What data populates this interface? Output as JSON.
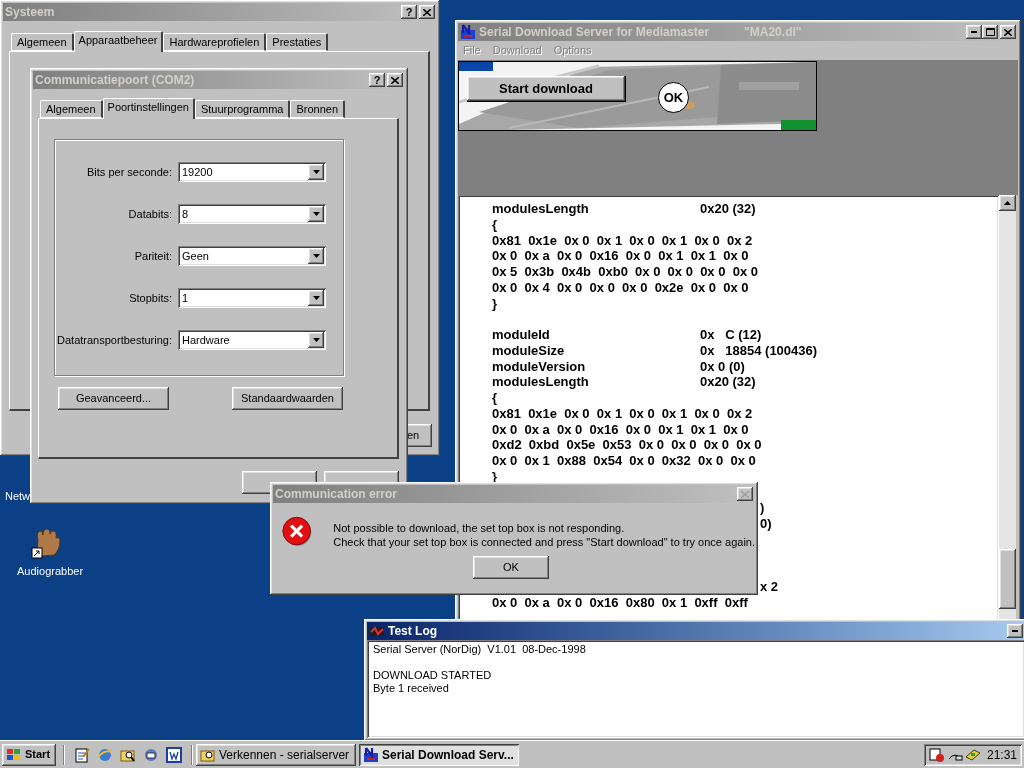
{
  "desktop_icons": [
    {
      "label": "Netw"
    },
    {
      "label": "Audiograbber"
    }
  ],
  "system_window": {
    "title": "Systeem",
    "active": false,
    "title_buttons": [
      {
        "kind": "help",
        "label": "?",
        "disabled": false
      },
      {
        "kind": "close",
        "disabled": false
      }
    ],
    "tabs": [
      {
        "label": "Algemeen",
        "selected": false
      },
      {
        "label": "Apparaatbeheer",
        "selected": true
      },
      {
        "label": "Hardwareprofielen",
        "selected": false
      },
      {
        "label": "Prestaties",
        "selected": false
      }
    ],
    "button_fragment": "en"
  },
  "port_dialog": {
    "title": "Communicatiepoort (COM2)",
    "active": false,
    "title_buttons": [
      {
        "kind": "help",
        "label": "?",
        "disabled": false
      },
      {
        "kind": "close",
        "disabled": false
      }
    ],
    "tabs": [
      {
        "label": "Algemeen",
        "selected": false
      },
      {
        "label": "Poortinstellingen",
        "selected": true
      },
      {
        "label": "Stuurprogramma",
        "selected": false
      },
      {
        "label": "Bronnen",
        "selected": false
      }
    ],
    "fields": [
      {
        "label": "Bits per seconde:",
        "value": "19200"
      },
      {
        "label": "Databits:",
        "value": "8"
      },
      {
        "label": "Pariteit:",
        "value": "Geen"
      },
      {
        "label": "Stopbits:",
        "value": "1"
      },
      {
        "label": "Datatransportbesturing:",
        "value": "Hardware"
      }
    ],
    "buttons": [
      "Geavanceerd...",
      "Standaardwaarden"
    ]
  },
  "serial_window": {
    "title": "Serial Download Server for Mediamaster",
    "file": "\"MA20.dl\"",
    "active": false,
    "title_buttons": [
      {
        "kind": "minimize",
        "disabled": false
      },
      {
        "kind": "maximize",
        "disabled": false
      },
      {
        "kind": "close",
        "disabled": false
      }
    ],
    "menu": [
      {
        "label": "File",
        "disabled": true
      },
      {
        "label": "Download",
        "disabled": true
      },
      {
        "label": "Options",
        "disabled": true
      }
    ],
    "start_button": "Start download",
    "status": "OK",
    "log_lines": [
      {
        "kind": "pair",
        "name": "modulesLength",
        "value": "0x20 (32)"
      },
      {
        "kind": "brace",
        "text": "{"
      },
      {
        "kind": "hex",
        "text": "0x81  0x1e  0x 0  0x 1  0x 0  0x 1  0x 0  0x 2"
      },
      {
        "kind": "hex",
        "text": "0x 0  0x a  0x 0  0x16  0x 0  0x 1  0x 1  0x 0"
      },
      {
        "kind": "hex",
        "text": "0x 5  0x3b  0x4b  0xb0  0x 0  0x 0  0x 0  0x 0"
      },
      {
        "kind": "hex",
        "text": "0x 0  0x 4  0x 0  0x 0  0x 0  0x2e  0x 0  0x 0"
      },
      {
        "kind": "brace",
        "text": "}"
      },
      {
        "kind": "blank"
      },
      {
        "kind": "pair",
        "name": "moduleId",
        "value": "0x   C (12)"
      },
      {
        "kind": "pair",
        "name": "moduleSize",
        "value": "0x   18854 (100436)"
      },
      {
        "kind": "pair",
        "name": "moduleVersion",
        "value": "0x 0 (0)"
      },
      {
        "kind": "pair",
        "name": "modulesLength",
        "value": "0x20 (32)"
      },
      {
        "kind": "brace",
        "text": "{"
      },
      {
        "kind": "hex",
        "text": "0x81  0x1e  0x 0  0x 1  0x 0  0x 1  0x 0  0x 2"
      },
      {
        "kind": "hex",
        "text": "0x 0  0x a  0x 0  0x16  0x 0  0x 1  0x 1  0x 0"
      },
      {
        "kind": "hex",
        "text": "0xd2  0xbd  0x5e  0x53  0x 0  0x 0  0x 0  0x 0"
      },
      {
        "kind": "hex",
        "text": "0x 0  0x 1  0x88  0x54  0x 0  0x32  0x 0  0x 0"
      },
      {
        "kind": "brace",
        "text": "}"
      },
      {
        "kind": "blank"
      },
      {
        "kind": "fragment",
        "text": ")"
      },
      {
        "kind": "fragment",
        "text": "0)"
      },
      {
        "kind": "blank"
      },
      {
        "kind": "blank"
      },
      {
        "kind": "blank"
      },
      {
        "kind": "fragment",
        "text": "x 2"
      },
      {
        "kind": "hex",
        "text": "0x 0  0x a  0x 0  0x16  0x80  0x 1  0xff  0xff"
      }
    ]
  },
  "error_dialog": {
    "title": "Communication error",
    "active": false,
    "title_buttons": [
      {
        "kind": "close",
        "disabled": true
      }
    ],
    "message": [
      "Not possible to download, the set top box is not responding.",
      "Check that your set top box is connected and press \"Start download\" to try once again."
    ],
    "button": "OK"
  },
  "test_log": {
    "title": "Test Log",
    "active": true,
    "title_buttons": [
      {
        "kind": "minimize",
        "disabled": false
      }
    ],
    "lines": [
      {
        "kind": "text",
        "text": "Serial Server (NorDig)  V1.01  08-Dec-1998"
      },
      {
        "kind": "blank"
      },
      {
        "kind": "text",
        "text": "DOWNLOAD STARTED"
      },
      {
        "kind": "text",
        "text": "Byte 1 received"
      }
    ]
  },
  "taskbar": {
    "start": "Start",
    "tasks": [
      {
        "label": "Verkennen - serialserver",
        "selected": false
      },
      {
        "label": "Serial Download Serv...",
        "selected": true
      }
    ],
    "clock": "21:31"
  }
}
